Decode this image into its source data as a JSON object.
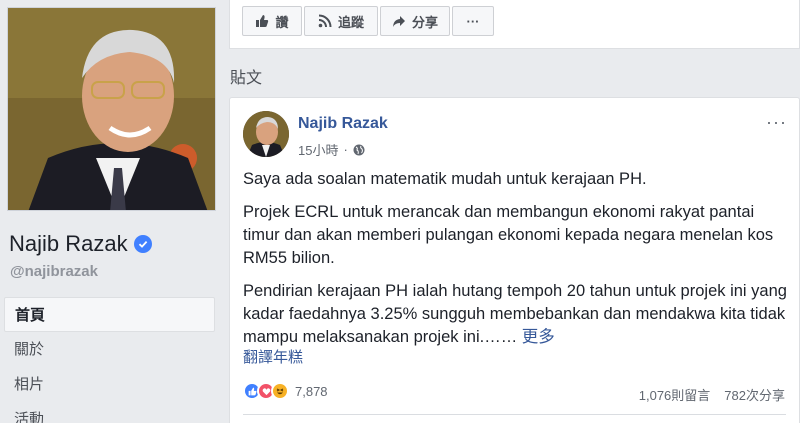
{
  "profile": {
    "name": "Najib Razak",
    "handle": "@najibrazak"
  },
  "nav": {
    "items": [
      {
        "label": "首頁"
      },
      {
        "label": "關於"
      },
      {
        "label": "相片"
      },
      {
        "label": "活動"
      }
    ]
  },
  "actions": {
    "like": "讚",
    "follow": "追蹤",
    "share": "分享",
    "more": "···"
  },
  "section_title": "貼文",
  "post": {
    "author": "Najib Razak",
    "time": "15小時",
    "paragraphs": [
      "Saya ada soalan matematik mudah untuk kerajaan PH.",
      "Projek ECRL untuk merancak dan membangun ekonomi rakyat pantai timur dan akan memberi pulangan ekonomi kepada negara menelan kos RM55 bilion.",
      "Pendirian kerajaan PH ialah hutang tempoh 20 tahun untuk projek ini yang kadar faedahnya 3.25% sungguh membebankan dan mendakwa kita tidak mampu melaksanakan projek ini.……"
    ],
    "see_more": "更多",
    "translate": "翻譯年糕",
    "reaction_count": "7,878",
    "comments": "1,076則留言",
    "shares": "782次分享",
    "more": "···"
  },
  "colors": {
    "link": "#365899",
    "like": "#4080ff",
    "love": "#f25268",
    "haha": "#f7b125"
  }
}
